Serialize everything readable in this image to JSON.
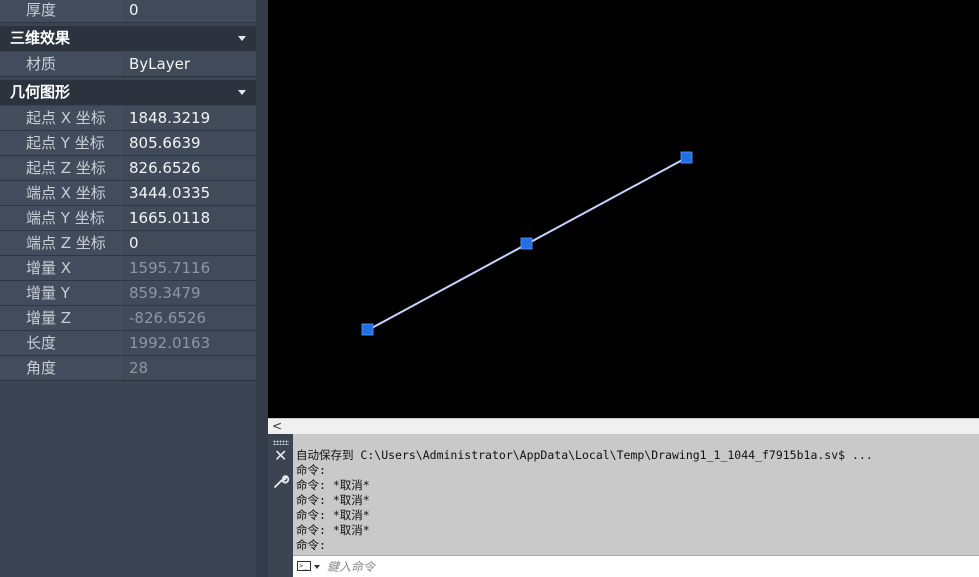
{
  "properties": {
    "general_partial": {
      "label": "厚度",
      "value": "0"
    },
    "category_3d": {
      "title": "三维效果"
    },
    "material": {
      "label": "材质",
      "value": "ByLayer"
    },
    "category_geometry": {
      "title": "几何图形"
    },
    "geometry": [
      {
        "label": "起点 X 坐标",
        "value": "1848.3219",
        "readonly": false
      },
      {
        "label": "起点 Y 坐标",
        "value": "805.6639",
        "readonly": false
      },
      {
        "label": "起点 Z 坐标",
        "value": "826.6526",
        "readonly": false
      },
      {
        "label": "端点 X 坐标",
        "value": "3444.0335",
        "readonly": false
      },
      {
        "label": "端点 Y 坐标",
        "value": "1665.0118",
        "readonly": false
      },
      {
        "label": "端点 Z 坐标",
        "value": "0",
        "readonly": false
      },
      {
        "label": "增量 X",
        "value": "1595.7116",
        "readonly": true
      },
      {
        "label": "增量 Y",
        "value": "859.3479",
        "readonly": true
      },
      {
        "label": "增量 Z",
        "value": "-826.6526",
        "readonly": true
      },
      {
        "label": "长度",
        "value": "1992.0163",
        "readonly": true
      },
      {
        "label": "角度",
        "value": "28",
        "readonly": true
      }
    ]
  },
  "drawing": {
    "line_color": "#c8d4ff",
    "grip_color": "#1f6fe6",
    "background": "#000000"
  },
  "scrollbar": {
    "left_arrow": "<"
  },
  "command": {
    "history": [
      "自动保存到 C:\\Users\\Administrator\\AppData\\Local\\Temp\\Drawing1_1_1044_f7915b1a.sv$ ...",
      "命令:",
      "命令: *取消*",
      "命令: *取消*",
      "命令: *取消*",
      "命令: *取消*",
      "命令:"
    ],
    "placeholder": "鍵入命令",
    "close_icon": "close-icon",
    "settings_icon": "wrench-icon"
  }
}
